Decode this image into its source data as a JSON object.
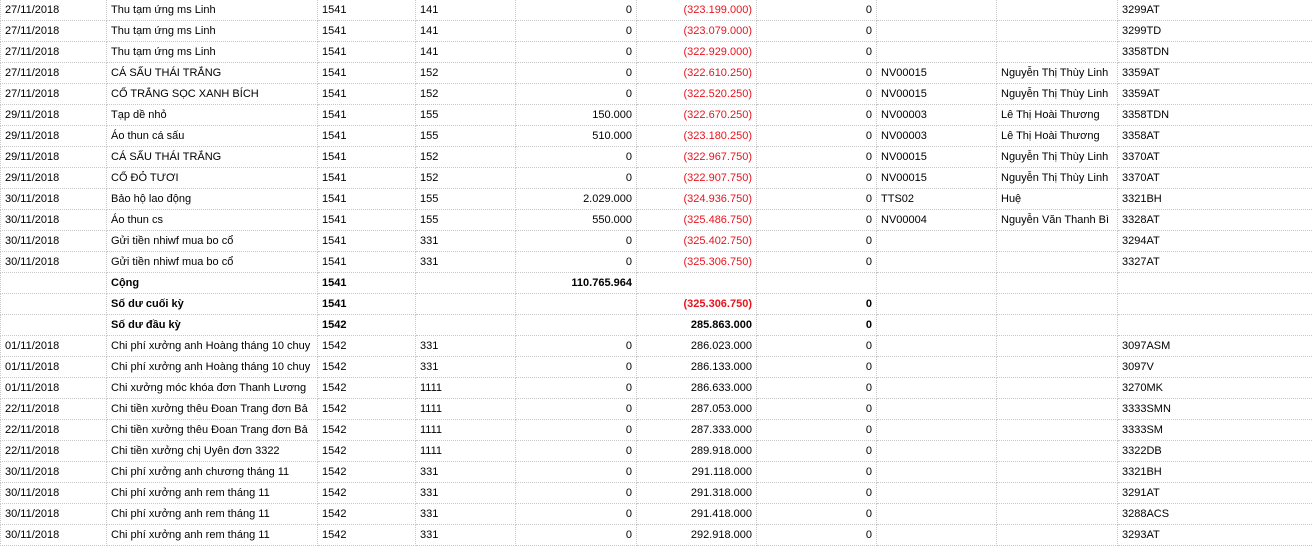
{
  "colors": {
    "negative": "#e8141e",
    "gridline": "#c8c8c8"
  },
  "rows": [
    {
      "c": [
        "27/11/2018",
        "Thu tạm ứng ms Linh",
        "1541",
        "141",
        "0",
        "(323.199.000)",
        "0",
        "",
        "",
        "3299AT"
      ]
    },
    {
      "c": [
        "27/11/2018",
        "Thu tạm ứng ms Linh",
        "1541",
        "141",
        "0",
        "(323.079.000)",
        "0",
        "",
        "",
        "3299TD"
      ]
    },
    {
      "c": [
        "27/11/2018",
        "Thu tạm ứng ms Linh",
        "1541",
        "141",
        "0",
        "(322.929.000)",
        "0",
        "",
        "",
        "3358TDN"
      ]
    },
    {
      "c": [
        "27/11/2018",
        "CÁ SẤU THÁI TRẮNG",
        "1541",
        "152",
        "0",
        "(322.610.250)",
        "0",
        "NV00015",
        "Nguyễn Thị Thùy Linh",
        "3359AT"
      ]
    },
    {
      "c": [
        "27/11/2018",
        "CỔ TRẮNG SỌC XANH BÍCH",
        "1541",
        "152",
        "0",
        "(322.520.250)",
        "0",
        "NV00015",
        "Nguyễn Thị Thùy Linh",
        "3359AT"
      ]
    },
    {
      "c": [
        "29/11/2018",
        "Tạp dề nhỏ",
        "1541",
        "155",
        "150.000",
        "(322.670.250)",
        "0",
        "NV00003",
        "Lê Thị Hoài Thương",
        "3358TDN"
      ]
    },
    {
      "c": [
        "29/11/2018",
        "Áo thun cá sấu",
        "1541",
        "155",
        "510.000",
        "(323.180.250)",
        "0",
        "NV00003",
        "Lê Thị Hoài Thương",
        "3358AT"
      ]
    },
    {
      "c": [
        "29/11/2018",
        "CÁ SẤU THÁI TRẮNG",
        "1541",
        "152",
        "0",
        "(322.967.750)",
        "0",
        "NV00015",
        "Nguyễn Thị Thùy Linh",
        "3370AT"
      ]
    },
    {
      "c": [
        "29/11/2018",
        "CỔ ĐỎ TƯƠI",
        "1541",
        "152",
        "0",
        "(322.907.750)",
        "0",
        "NV00015",
        "Nguyễn Thị Thùy Linh",
        "3370AT"
      ]
    },
    {
      "c": [
        "30/11/2018",
        "Bảo hộ lao động",
        "1541",
        "155",
        "2.029.000",
        "(324.936.750)",
        "0",
        "TTS02",
        "Huệ",
        "3321BH"
      ]
    },
    {
      "c": [
        "30/11/2018",
        "Áo thun cs",
        "1541",
        "155",
        "550.000",
        "(325.486.750)",
        "0",
        "NV00004",
        "Nguyễn Văn Thanh Bì",
        "3328AT"
      ]
    },
    {
      "c": [
        "30/11/2018",
        "Gửi tiền nhiwf mua bo cổ",
        "1541",
        "331",
        "0",
        "(325.402.750)",
        "0",
        "",
        "",
        "3294AT"
      ]
    },
    {
      "c": [
        "30/11/2018",
        "Gửi tiền nhiwf mua bo cổ",
        "1541",
        "331",
        "0",
        "(325.306.750)",
        "0",
        "",
        "",
        "3327AT"
      ]
    },
    {
      "bold": true,
      "c": [
        "",
        "Cộng",
        "1541",
        "",
        "110.765.964",
        "",
        "",
        "",
        "",
        ""
      ]
    },
    {
      "bold": true,
      "c": [
        "",
        "Số dư cuối kỳ",
        "1541",
        "",
        "",
        "(325.306.750)",
        "0",
        "",
        "",
        ""
      ]
    },
    {
      "bold": true,
      "c": [
        "",
        "Số dư đầu kỳ",
        "1542",
        "",
        "",
        "285.863.000",
        "0",
        "",
        "",
        ""
      ]
    },
    {
      "c": [
        "01/11/2018",
        "Chi phí xưởng anh Hoàng tháng 10 chuy",
        "1542",
        "331",
        "0",
        "286.023.000",
        "0",
        "",
        "",
        "3097ASM"
      ]
    },
    {
      "c": [
        "01/11/2018",
        "Chi phí xưởng anh Hoàng tháng 10 chuy",
        "1542",
        "331",
        "0",
        "286.133.000",
        "0",
        "",
        "",
        "3097V"
      ]
    },
    {
      "c": [
        "01/11/2018",
        "Chi xưởng móc khóa đơn Thanh Lương",
        "1542",
        "1111",
        "0",
        "286.633.000",
        "0",
        "",
        "",
        "3270MK"
      ]
    },
    {
      "c": [
        "22/11/2018",
        "Chi tiền xưởng thêu Đoan Trang đơn Bả",
        "1542",
        "1111",
        "0",
        "287.053.000",
        "0",
        "",
        "",
        "3333SMN"
      ]
    },
    {
      "c": [
        "22/11/2018",
        "Chi tiền xưởng thêu Đoan Trang đơn Bả",
        "1542",
        "1111",
        "0",
        "287.333.000",
        "0",
        "",
        "",
        "3333SM"
      ]
    },
    {
      "c": [
        "22/11/2018",
        "Chi tiền xưởng chị Uyên đơn 3322",
        "1542",
        "1111",
        "0",
        "289.918.000",
        "0",
        "",
        "",
        "3322DB"
      ]
    },
    {
      "c": [
        "30/11/2018",
        "Chi phí xưởng anh chương tháng 11",
        "1542",
        "331",
        "0",
        "291.118.000",
        "0",
        "",
        "",
        "3321BH"
      ]
    },
    {
      "c": [
        "30/11/2018",
        "Chi phí xưởng anh rem tháng 11",
        "1542",
        "331",
        "0",
        "291.318.000",
        "0",
        "",
        "",
        "3291AT"
      ]
    },
    {
      "c": [
        "30/11/2018",
        "Chi phí xưởng anh rem tháng 11",
        "1542",
        "331",
        "0",
        "291.418.000",
        "0",
        "",
        "",
        "3288ACS"
      ]
    },
    {
      "c": [
        "30/11/2018",
        "Chi phí xưởng anh rem tháng 11",
        "1542",
        "331",
        "0",
        "292.918.000",
        "0",
        "",
        "",
        "3293AT"
      ]
    }
  ]
}
